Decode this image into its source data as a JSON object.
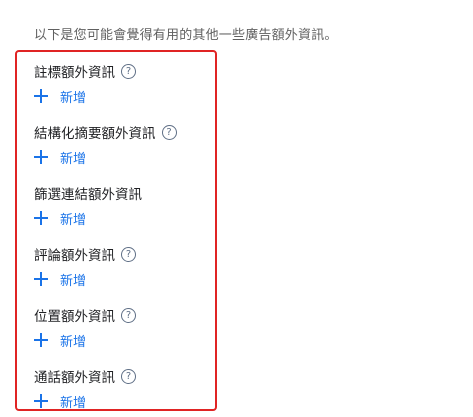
{
  "intro_text": "以下是您可能會覺得有用的其他一些廣告額外資訊。",
  "help_glyph": "?",
  "add_label": "新增",
  "extensions": [
    {
      "title": "註標額外資訊",
      "has_help": true
    },
    {
      "title": "結構化摘要額外資訊",
      "has_help": true
    },
    {
      "title": "篩選連結額外資訊",
      "has_help": false
    },
    {
      "title": "評論額外資訊",
      "has_help": true
    },
    {
      "title": "位置額外資訊",
      "has_help": true
    },
    {
      "title": "通話額外資訊",
      "has_help": true
    }
  ],
  "colors": {
    "highlight_border": "#e02424",
    "link_blue": "#1a73e8",
    "title_text": "#202124",
    "intro_text": "#606060"
  }
}
